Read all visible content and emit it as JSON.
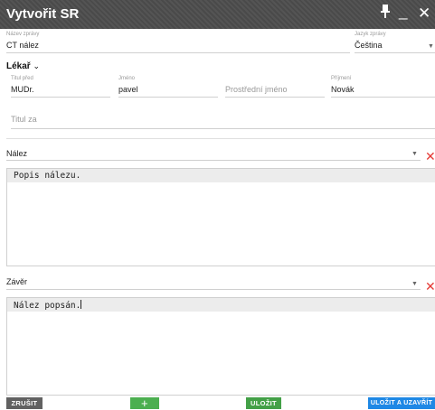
{
  "window": {
    "title": "Vytvořit SR"
  },
  "report_name": {
    "label": "Název zprávy",
    "value": "CT nález"
  },
  "language": {
    "label": "Jazyk zprávy",
    "value": "Čeština"
  },
  "doctor": {
    "section_label": "Lékař",
    "title_before": {
      "label": "Titul před",
      "value": "MUDr."
    },
    "first_name": {
      "label": "Jméno",
      "value": "pavel"
    },
    "middle_name": {
      "placeholder": "Prostřední jméno"
    },
    "last_name": {
      "label": "Příjmení",
      "value": "Novák"
    },
    "title_after": {
      "placeholder": "Titul za"
    }
  },
  "finding": {
    "select_label": "Nález",
    "text": "Popis nálezu."
  },
  "conclusion": {
    "select_label": "Závěr",
    "text": "Nález popsán."
  },
  "buttons": {
    "cancel": "ZRUŠIT",
    "add": "+",
    "save": "ULOŽIT",
    "save_close": "ULOŽIT A UZAVŘÍT"
  },
  "colors": {
    "cancel": "#616161",
    "add": "#4caf50",
    "save": "#43a047",
    "save_close": "#1e88e5",
    "remove": "#e53935"
  }
}
